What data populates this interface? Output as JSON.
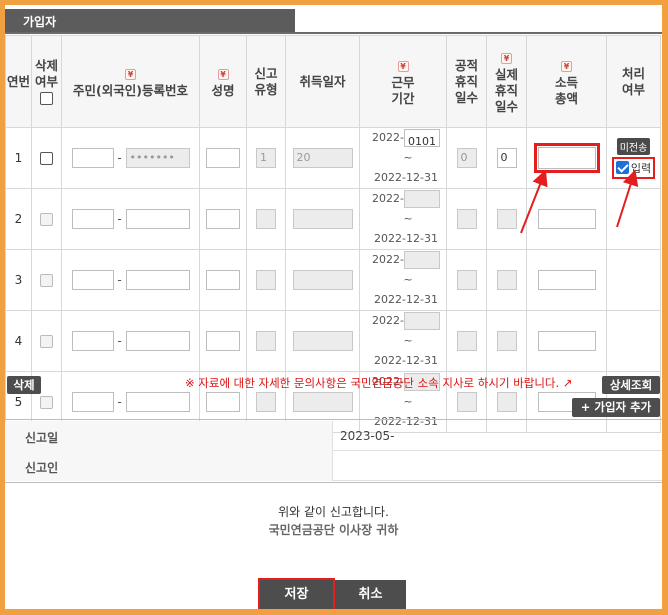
{
  "tab": {
    "title": "가입자"
  },
  "columns": {
    "no": "연번",
    "delete": [
      "삭제",
      "여부"
    ],
    "rrn": "주민(외국인)등록번호",
    "name": "성명",
    "report_type": [
      "신고",
      "유형"
    ],
    "acquire_date": "취득일자",
    "work_period": [
      "근무",
      "기간"
    ],
    "official_leave": [
      "공적",
      "휴직",
      "일수"
    ],
    "actual_leave": [
      "실제",
      "휴직",
      "일수"
    ],
    "income": [
      "소득",
      "총액"
    ],
    "process": [
      "처리",
      "여부"
    ],
    "required_mark": "¥"
  },
  "rows": [
    {
      "no": "1",
      "rrn_tail": "•••••••",
      "report_type": "1",
      "acquire_date": "20",
      "period_year": "2022-",
      "period_start": "0101",
      "period_end": "2022-12-31",
      "official_leave": "0",
      "actual_leave": "0",
      "status": "미전송",
      "input_label": "입력"
    },
    {
      "no": "2",
      "period_year": "2022-",
      "period_end": "2022-12-31"
    },
    {
      "no": "3",
      "period_year": "2022-",
      "period_end": "2022-12-31"
    },
    {
      "no": "4",
      "period_year": "2022-",
      "period_end": "2022-12-31"
    },
    {
      "no": "5",
      "period_year": "2022-",
      "period_end": "2022-12-31"
    }
  ],
  "actions": {
    "delete": "삭제",
    "notice": "※ 자료에 대한 자세한 문의사항은 국민연금공단 소속 지사로 하시기 바랍니다.",
    "detail": "상세조회",
    "add_member": "+ 가입자 추가"
  },
  "report": {
    "date_label": "신고일",
    "date_value": "2023-05-",
    "reporter_label": "신고인",
    "declaration": "위와 같이 신고합니다.",
    "recipient": "국민연금공단 이사장 귀하"
  },
  "buttons": {
    "save": "저장",
    "cancel": "취소"
  },
  "colors": {
    "page_border": "#f0a040",
    "dark_button": "#4d4d4d",
    "highlight": "#e41e1e",
    "notice": "#dd1111"
  }
}
